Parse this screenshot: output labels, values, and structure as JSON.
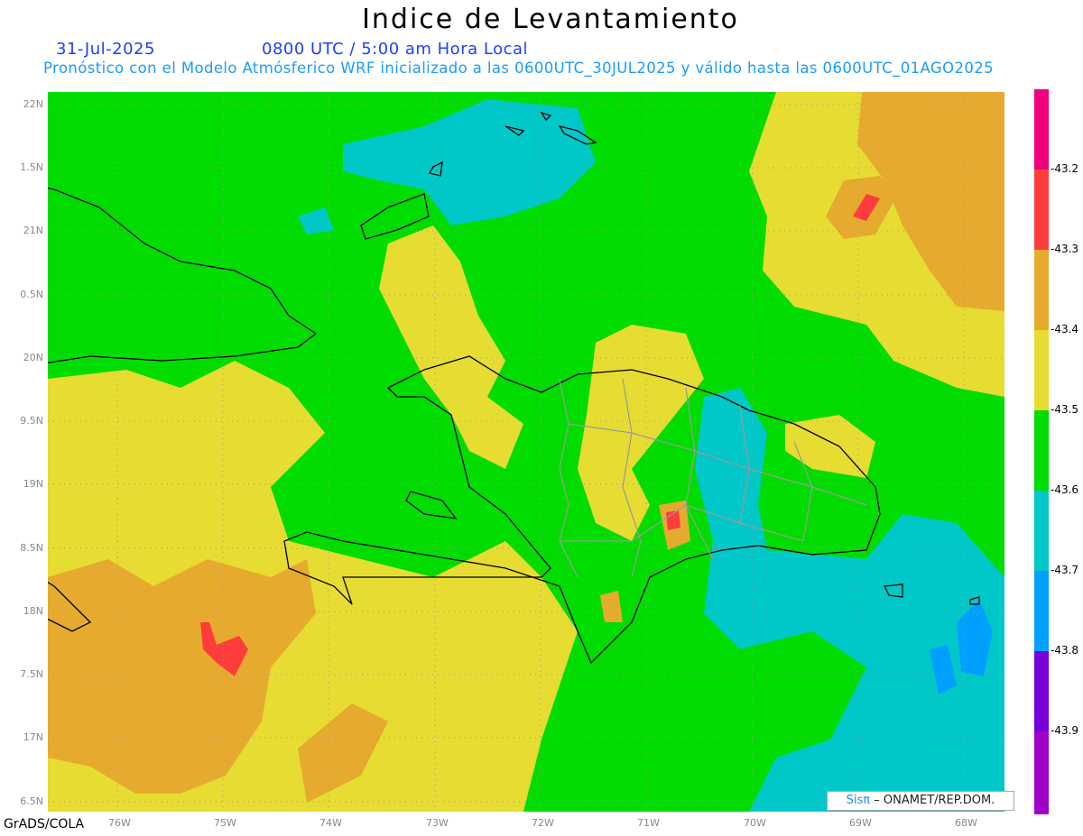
{
  "header": {
    "title": "Indice de Levantamiento",
    "date": "31-Jul-2025",
    "time": "0800 UTC / 5:00 am Hora Local",
    "description": "Pronóstico con el Modelo Atmósferico WRF inicializado a las 0600UTC_30JUL2025 y válido hasta las  0600UTC_01AGO2025"
  },
  "axes": {
    "y_labels": [
      "22N",
      "1.5N",
      "21N",
      "0.5N",
      "20N",
      "9.5N",
      "19N",
      "8.5N",
      "18N",
      "7.5N",
      "17N",
      "6.5N"
    ],
    "x_labels": [
      "76W",
      "75W",
      "74W",
      "73W",
      "72W",
      "71W",
      "70W",
      "69W",
      "68W"
    ]
  },
  "colorbar": {
    "labels": [
      "-43.2",
      "-43.3",
      "-43.4",
      "-43.5",
      "-43.6",
      "-43.7",
      "-43.8",
      "-43.9"
    ],
    "colors": [
      "#f0007e",
      "#ff3c3c",
      "#e6ab2e",
      "#e6dc32",
      "#00dc00",
      "#00c8c8",
      "#00a0ff",
      "#7800dc",
      "#a000c8"
    ]
  },
  "footer": {
    "software": "GrADS/COLA",
    "credit_logo": "Sisπ",
    "credit_text": "– ONAMET/REP.DOM."
  }
}
